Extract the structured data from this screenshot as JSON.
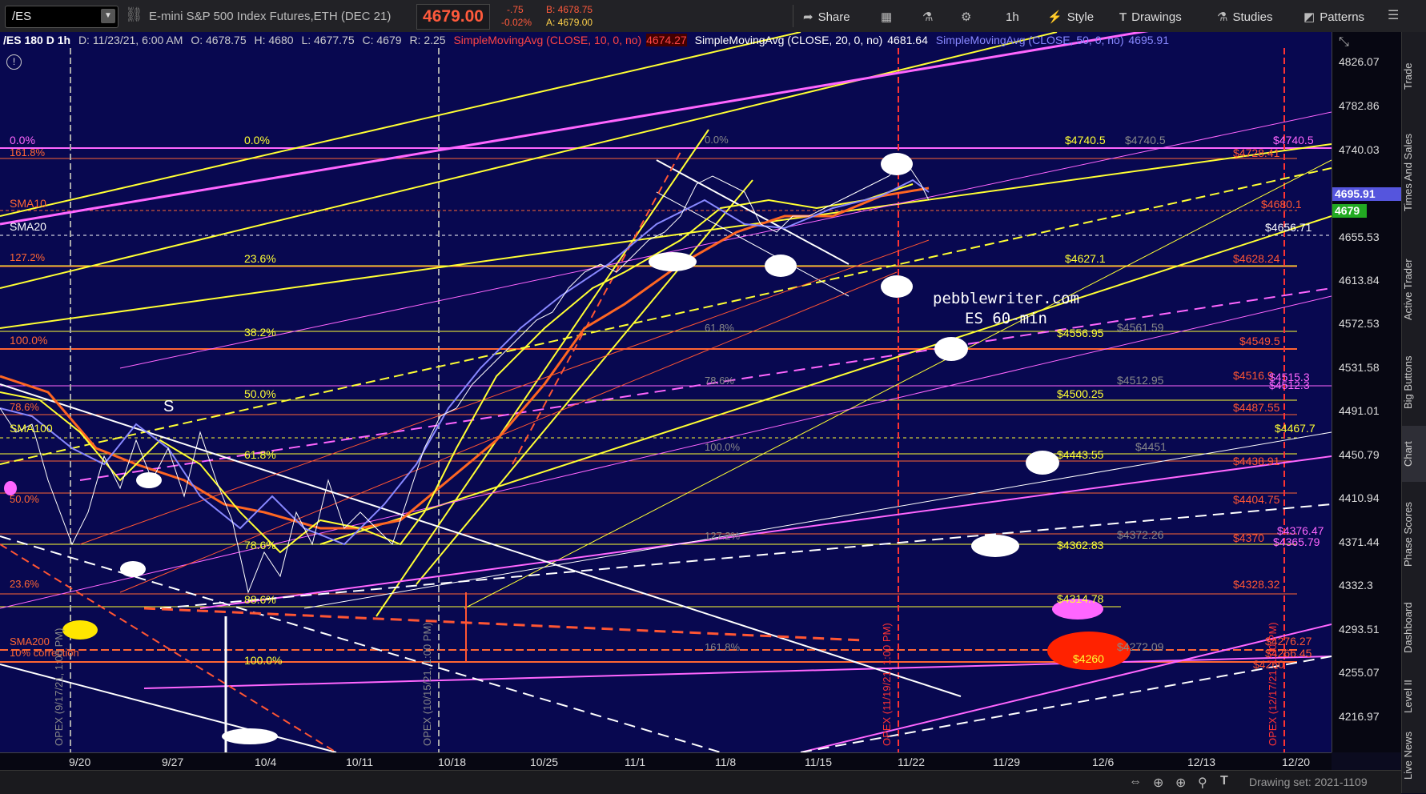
{
  "toolbar": {
    "symbol": "/ES",
    "instrument": "E-mini S&P 500 Index Futures,ETH (DEC 21)",
    "last_price": "4679.00",
    "change": "-.75",
    "change_pct": "-0.02%",
    "bid": "B: 4678.75",
    "ask": "A: 4679.00",
    "share": "Share",
    "timeframe": "1h",
    "style": "Style",
    "drawings": "Drawings",
    "studies": "Studies",
    "patterns": "Patterns"
  },
  "header": {
    "symbol_tf": "/ES 180 D 1h",
    "date": "D: 11/23/21, 6:00 AM",
    "open": "O: 4678.75",
    "high": "H: 4680",
    "low": "L: 4677.75",
    "close": "C: 4679",
    "range": "R: 2.25",
    "sma10_name": "SimpleMovingAvg (CLOSE, 10, 0, no)",
    "sma10_val": "4674.27",
    "sma20_name": "SimpleMovingAvg (CLOSE, 20, 0, no)",
    "sma20_val": "4681.64",
    "sma50_name": "SimpleMovingAvg (CLOSE, 50, 0, no)",
    "sma50_val": "4695.91"
  },
  "price_axis": [
    "4826.07",
    "4782.86",
    "4740.03",
    "4655.53",
    "4613.84",
    "4572.53",
    "4531.58",
    "4491.01",
    "4450.79",
    "4410.94",
    "4371.44",
    "4332.3",
    "4293.51",
    "4255.07",
    "4216.97"
  ],
  "price_tags": {
    "sma50": "4695.91",
    "last": "4679"
  },
  "date_axis": [
    "9/20",
    "9/27",
    "10/4",
    "10/11",
    "10/18",
    "10/25",
    "11/1",
    "11/8",
    "11/15",
    "11/22",
    "11/29",
    "12/6",
    "12/13",
    "12/20"
  ],
  "annotations": {
    "watermark_1": "pebblewriter.com",
    "watermark_2": "ES 60-min",
    "s_label": "S",
    "labels_left": [
      "0.0%",
      "161.8%",
      "SMA10",
      "SMA20",
      "127.2%",
      "100.0%",
      "78.6%",
      "SMA100",
      "50.0%",
      "23.6%",
      "SMA200",
      "10% correction"
    ],
    "fib_mid": [
      "0.0%",
      "23.6%",
      "38.2%",
      "50.0%",
      "61.8%",
      "78.6%",
      "88.6%",
      "100.0%"
    ],
    "fib_right": [
      "0.0%",
      "61.8%",
      "78.6%",
      "100.0%",
      "127.2%",
      "161.8%"
    ],
    "yellow_levels": [
      "$4740.5",
      "$4627.1",
      "$4556.95",
      "$4500.25",
      "$4467.7",
      "$4443.55",
      "$4362.83",
      "$4314.78",
      "$4260"
    ],
    "gray_levels": [
      "$4740.5",
      "$4561.59",
      "$4512.95",
      "$4451",
      "$4372.26",
      "$4272.09"
    ],
    "red_levels": [
      "$4728.41",
      "$4680.1",
      "$4628.24",
      "$4549.5",
      "$4516.9",
      "$4487.55",
      "$4438.91",
      "$4404.75",
      "$4370",
      "$4328.32",
      "$4276.27",
      "$4266.45",
      "$4260"
    ],
    "pink_levels": [
      "$4740.5",
      "$4515.3",
      "$4512.3",
      "$4376.47",
      "$4365.79"
    ],
    "white_level": "$4656.71",
    "opex": [
      "OPEX (9/17/21, 1:00 PM)",
      "OPEX (10/15/21, 1:00 PM)",
      "OPEX (11/19/21, 1:00 PM)",
      "OPEX (12/17/21, 1:00 PM)"
    ]
  },
  "sidebar": [
    "Trade",
    "Times And Sales",
    "Active Trader",
    "Big Buttons",
    "Chart",
    "Phase Scores",
    "Dashboard",
    "Level II",
    "Live News"
  ],
  "status": {
    "drawing_set": "Drawing set: 2021-1109"
  },
  "colors": {
    "background": "#080850",
    "price_up": "#ff5a3c",
    "fib_yellow": "#ffff33",
    "fib_red": "#ff5533",
    "fib_pink": "#ff66ff"
  }
}
